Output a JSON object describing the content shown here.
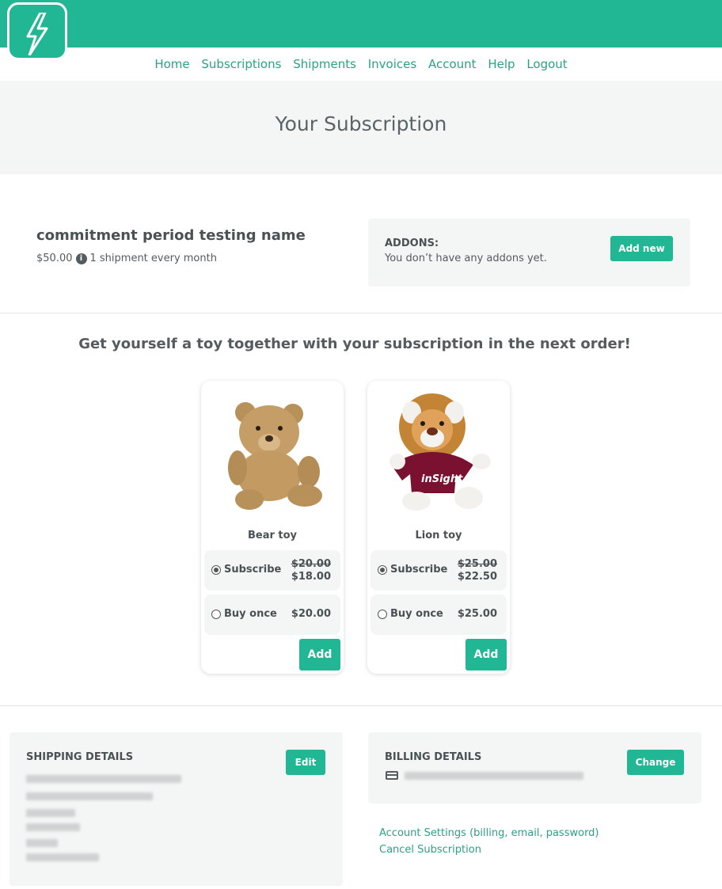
{
  "brand": {
    "color": "#22b794",
    "logo_icon": "lightning-bolt-icon"
  },
  "nav": [
    "Home",
    "Subscriptions",
    "Shipments",
    "Invoices",
    "Account",
    "Help",
    "Logout"
  ],
  "hero": {
    "title": "Your Subscription"
  },
  "plan": {
    "name": "commitment period testing name",
    "price": "$50.00",
    "frequency": "1 shipment every month"
  },
  "addons": {
    "title": "ADDONS:",
    "empty_text": "You don’t have any addons yet.",
    "add_label": "Add new"
  },
  "promo": {
    "title": "Get yourself a toy together with your subscription in the next order!",
    "products": [
      {
        "name": "Bear toy",
        "subscribe_label": "Subscribe",
        "subscribe_old_price": "$20.00",
        "subscribe_price": "$18.00",
        "once_label": "Buy once",
        "once_price": "$20.00",
        "add_label": "Add",
        "selected": "subscribe"
      },
      {
        "name": "Lion toy",
        "shirt_text": "inSight",
        "subscribe_label": "Subscribe",
        "subscribe_old_price": "$25.00",
        "subscribe_price": "$22.50",
        "once_label": "Buy once",
        "once_price": "$25.00",
        "add_label": "Add",
        "selected": "subscribe"
      }
    ]
  },
  "shipping": {
    "title": "SHIPPING DETAILS",
    "edit_label": "Edit"
  },
  "billing": {
    "title": "BILLING DETAILS",
    "change_label": "Change",
    "card_icon": "credit-card-icon"
  },
  "links": {
    "account_settings": "Account Settings (billing, email, password)",
    "cancel": "Cancel Subscription"
  }
}
